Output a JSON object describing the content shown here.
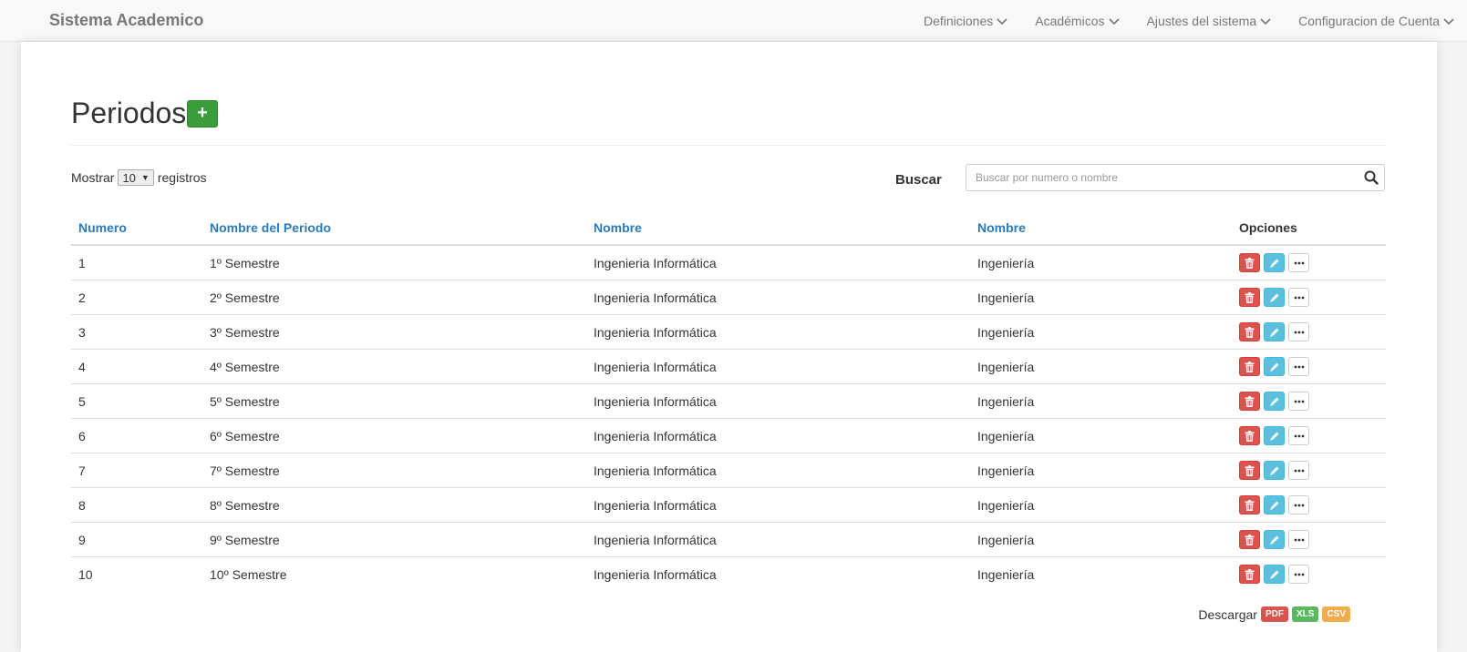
{
  "navbar": {
    "brand": "Sistema Academico",
    "menu": [
      {
        "label": "Definiciones"
      },
      {
        "label": "Académicos"
      },
      {
        "label": "Ajustes del sistema"
      },
      {
        "label": "Configuracion de Cuenta"
      }
    ]
  },
  "page": {
    "title": "Periodos",
    "add_label": "+"
  },
  "length": {
    "prefix": "Mostrar",
    "value": "10",
    "suffix": "registros"
  },
  "search": {
    "label": "Buscar",
    "placeholder": "Buscar por numero o nombre",
    "value": ""
  },
  "table": {
    "headers": [
      "Numero",
      "Nombre del Periodo",
      "Nombre",
      "Nombre",
      "Opciones"
    ],
    "rows": [
      {
        "numero": "1",
        "periodo": "1º Semestre",
        "nombre": "Ingenieria Informática",
        "nombre2": "Ingeniería"
      },
      {
        "numero": "2",
        "periodo": "2º Semestre",
        "nombre": "Ingenieria Informática",
        "nombre2": "Ingeniería"
      },
      {
        "numero": "3",
        "periodo": "3º Semestre",
        "nombre": "Ingenieria Informática",
        "nombre2": "Ingeniería"
      },
      {
        "numero": "4",
        "periodo": "4º Semestre",
        "nombre": "Ingenieria Informática",
        "nombre2": "Ingeniería"
      },
      {
        "numero": "5",
        "periodo": "5º Semestre",
        "nombre": "Ingenieria Informática",
        "nombre2": "Ingeniería"
      },
      {
        "numero": "6",
        "periodo": "6º Semestre",
        "nombre": "Ingenieria Informática",
        "nombre2": "Ingeniería"
      },
      {
        "numero": "7",
        "periodo": "7º Semestre",
        "nombre": "Ingenieria Informática",
        "nombre2": "Ingeniería"
      },
      {
        "numero": "8",
        "periodo": "8º Semestre",
        "nombre": "Ingenieria Informática",
        "nombre2": "Ingeniería"
      },
      {
        "numero": "9",
        "periodo": "9º Semestre",
        "nombre": "Ingenieria Informática",
        "nombre2": "Ingeniería"
      },
      {
        "numero": "10",
        "periodo": "10º Semestre",
        "nombre": "Ingenieria Informática",
        "nombre2": "Ingeniería"
      }
    ],
    "row_actions": {
      "delete_icon": "trash-icon",
      "edit_icon": "pencil-icon",
      "more_icon": "ellipsis-icon"
    }
  },
  "download": {
    "label": "Descargar",
    "formats": [
      {
        "label": "PDF",
        "color": "#d9534f"
      },
      {
        "label": "XLS",
        "color": "#5cb85c"
      },
      {
        "label": "CSV",
        "color": "#f0ad4e"
      }
    ]
  },
  "colors": {
    "link": "#2a7ab9",
    "add_button": "#3a9c3a",
    "delete_button": "#d9534f",
    "edit_button": "#5bc0de"
  }
}
